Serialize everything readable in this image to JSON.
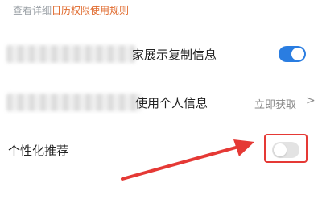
{
  "header": {
    "prefix": "查看详细",
    "rules_link": "日历权限使用规则"
  },
  "rows": [
    {
      "label": "家展示复制信息",
      "control": "toggle",
      "state": "on"
    },
    {
      "label": "使用个人信息",
      "control": "link",
      "action_label": "立即获取",
      "chevron": ">"
    },
    {
      "label": "个性化推荐",
      "control": "toggle",
      "state": "off"
    }
  ],
  "colors": {
    "accent": "#2a7de1",
    "link": "#e06a2d",
    "annotation": "#e53935",
    "toggle_off": "#e3e3e3"
  },
  "icons": {
    "chevron": "chevron-right-icon",
    "arrow": "annotation-arrow"
  }
}
